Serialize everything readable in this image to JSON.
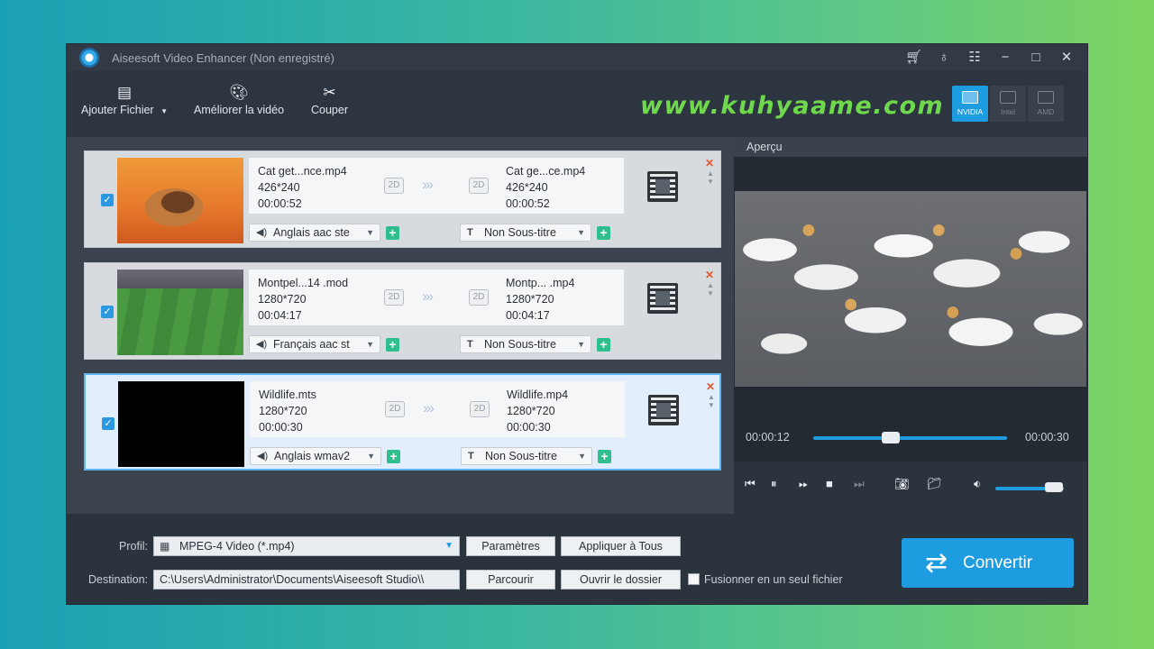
{
  "app": {
    "title": "Aiseesoft Video Enhancer (Non enregistré)"
  },
  "titlebar_icons": [
    "cart-icon",
    "pin-icon",
    "feedback-icon",
    "minimize-icon",
    "maximize-icon",
    "close-icon"
  ],
  "toolbar": {
    "add_file": "Ajouter Fichier",
    "enhance": "Améliorer la vidéo",
    "cut": "Couper",
    "gpu": [
      "NVIDIA",
      "Intel",
      "AMD"
    ],
    "gpu_active": "NVIDIA"
  },
  "watermark": "www.kuhyaame.com",
  "files": [
    {
      "src_name": "Cat get...nce.mp4",
      "src_res": "426*240",
      "src_dur": "00:00:52",
      "dst_name": "Cat ge...ce.mp4",
      "dst_res": "426*240",
      "dst_dur": "00:00:52",
      "audio": "Anglais aac ste",
      "subtitle": "Non Sous-titre",
      "mode_src": "2D",
      "mode_dst": "2D"
    },
    {
      "src_name": "Montpel...14 .mod",
      "src_res": "1280*720",
      "src_dur": "00:04:17",
      "dst_name": "Montp... .mp4",
      "dst_res": "1280*720",
      "dst_dur": "00:04:17",
      "audio": "Français aac st",
      "subtitle": "Non Sous-titre",
      "mode_src": "2D",
      "mode_dst": "2D"
    },
    {
      "src_name": "Wildlife.mts",
      "src_res": "1280*720",
      "src_dur": "00:00:30",
      "dst_name": "Wildlife.mp4",
      "dst_res": "1280*720",
      "dst_dur": "00:00:30",
      "audio": "Anglais wmav2",
      "subtitle": "Non Sous-titre",
      "mode_src": "2D",
      "mode_dst": "2D"
    }
  ],
  "preview": {
    "title": "Aperçu",
    "current_time": "00:00:12",
    "total_time": "00:00:30",
    "progress": 0.4,
    "volume": 0.85
  },
  "bottom": {
    "profile_label": "Profil:",
    "profile_value": "MPEG-4 Video (*.mp4)",
    "settings_btn": "Paramètres",
    "apply_all_btn": "Appliquer à Tous",
    "destination_label": "Destination:",
    "destination_value": "C:\\Users\\Administrator\\Documents\\Aiseesoft Studio\\\\",
    "browse_btn": "Parcourir",
    "open_folder_btn": "Ouvrir le dossier",
    "merge_label": "Fusionner en un seul fichier",
    "convert_btn": "Convertir"
  },
  "colors": {
    "accent": "#1e9ce0",
    "watermark": "#6fd84d",
    "add_green": "#2fbf8e",
    "delete_red": "#e2572c"
  }
}
